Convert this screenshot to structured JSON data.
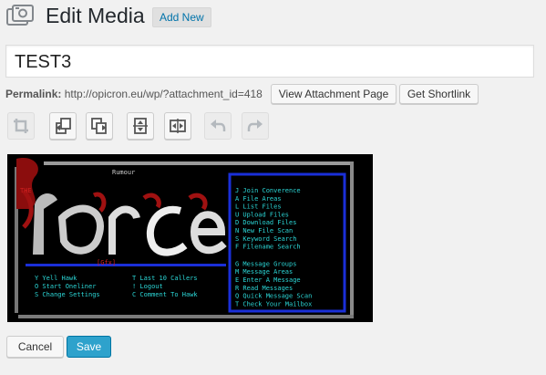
{
  "header": {
    "icon": "media-photo-icon",
    "title": "Edit Media",
    "add_new_label": "Add New"
  },
  "title_field": {
    "value": "TEST3"
  },
  "permalink": {
    "label": "Permalink:",
    "url": "http://opicron.eu/wp/?attachment_id=418",
    "view_button": "View Attachment Page",
    "shortlink_button": "Get Shortlink"
  },
  "image_toolbar": [
    {
      "name": "crop-icon",
      "enabled": false
    },
    {
      "name": "rotate-left-icon",
      "enabled": true
    },
    {
      "name": "rotate-right-icon",
      "enabled": true
    },
    {
      "name": "flip-vertical-icon",
      "enabled": true
    },
    {
      "name": "flip-horizontal-icon",
      "enabled": true
    },
    {
      "name": "undo-icon",
      "enabled": false
    },
    {
      "name": "redo-icon",
      "enabled": false
    }
  ],
  "preview": {
    "rumour": "Rumour",
    "the": "THE",
    "gfx": "[Gfx]",
    "menu_right": [
      "J Join Converence",
      "A File Areas",
      "L List Files",
      "U Upload Files",
      "D Download Files",
      "N New File Scan",
      "S Keyword Search",
      "F Filename Search",
      "G Message Groups",
      "M Message Areas",
      "E Enter A Message",
      "R Read Messages",
      "Q Quick Message Scan",
      "T Check Your Mailbox"
    ],
    "menu_left": [
      "Y Yell Hawk",
      "O Start Oneliner",
      "S Change Settings"
    ],
    "menu_mid": [
      "T Last 10 Callers",
      "! Logout",
      "C Comment To Hawk"
    ]
  },
  "actions": {
    "cancel_label": "Cancel",
    "save_label": "Save"
  },
  "colors": {
    "save_bg": "#2ea2cc",
    "link": "#0073aa"
  }
}
